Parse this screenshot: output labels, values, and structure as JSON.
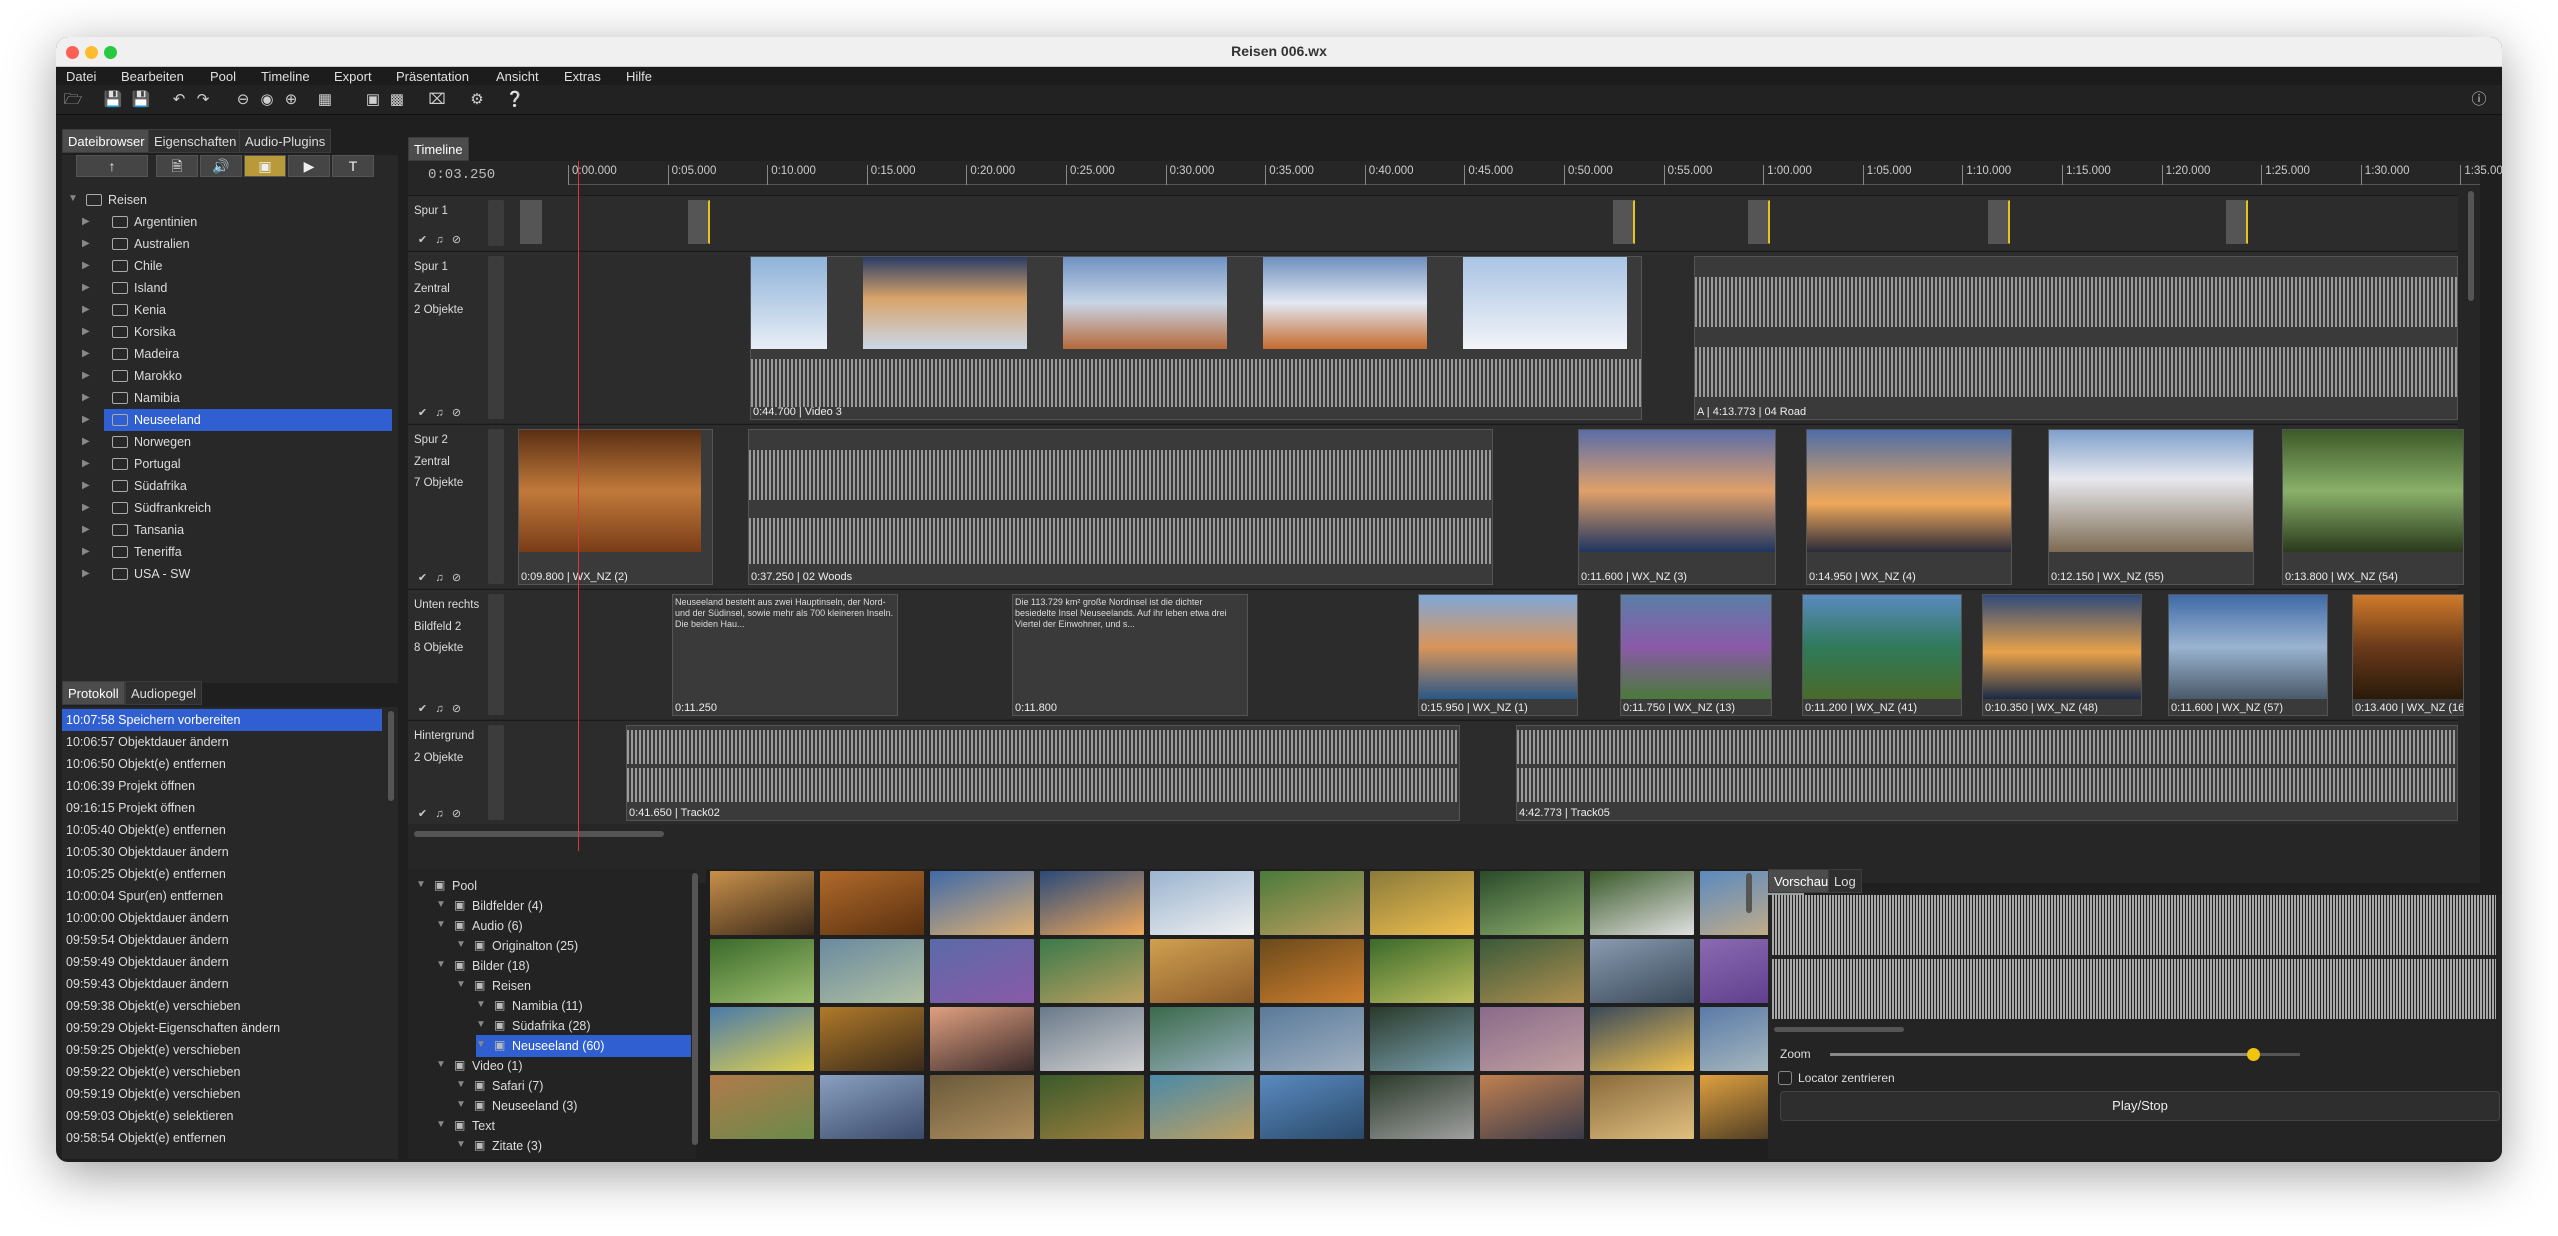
{
  "window": {
    "title": "Reisen 006.wx"
  },
  "menu": [
    "Datei",
    "Bearbeiten",
    "Pool",
    "Timeline",
    "Export",
    "Präsentation",
    "Ansicht",
    "Extras",
    "Hilfe"
  ],
  "left_tabs": [
    "Dateibrowser",
    "Eigenschaften",
    "Audio-Plugins"
  ],
  "file_tree": {
    "root": "Reisen",
    "items": [
      "Argentinien",
      "Australien",
      "Chile",
      "Island",
      "Kenia",
      "Korsika",
      "Madeira",
      "Marokko",
      "Namibia",
      "Neuseeland",
      "Norwegen",
      "Portugal",
      "Südafrika",
      "Südfrankreich",
      "Tansania",
      "Teneriffa",
      "USA - SW"
    ],
    "selected": "Neuseeland"
  },
  "log_tabs": [
    "Protokoll",
    "Audiopegel"
  ],
  "log": [
    {
      "time": "10:07:58",
      "text": "Speichern vorbereiten"
    },
    {
      "time": "10:06:57",
      "text": "Objektdauer ändern"
    },
    {
      "time": "10:06:50",
      "text": "Objekt(e) entfernen"
    },
    {
      "time": "10:06:39",
      "text": "Projekt öffnen"
    },
    {
      "time": "09:16:15",
      "text": "Projekt öffnen"
    },
    {
      "time": "10:05:40",
      "text": "Objekt(e) entfernen"
    },
    {
      "time": "10:05:30",
      "text": "Objektdauer ändern"
    },
    {
      "time": "10:05:25",
      "text": "Objekt(e) entfernen"
    },
    {
      "time": "10:00:04",
      "text": "Spur(en) entfernen"
    },
    {
      "time": "10:00:00",
      "text": "Objektdauer ändern"
    },
    {
      "time": "09:59:54",
      "text": "Objektdauer ändern"
    },
    {
      "time": "09:59:49",
      "text": "Objektdauer ändern"
    },
    {
      "time": "09:59:43",
      "text": "Objektdauer ändern"
    },
    {
      "time": "09:59:38",
      "text": "Objekt(e) verschieben"
    },
    {
      "time": "09:59:29",
      "text": "Objekt-Eigenschaften ändern"
    },
    {
      "time": "09:59:25",
      "text": "Objekt(e) verschieben"
    },
    {
      "time": "09:59:22",
      "text": "Objekt(e) verschieben"
    },
    {
      "time": "09:59:19",
      "text": "Objekt(e) verschieben"
    },
    {
      "time": "09:59:03",
      "text": "Objekt(e) selektieren"
    },
    {
      "time": "09:58:54",
      "text": "Objekt(e) entfernen"
    }
  ],
  "timeline": {
    "tab": "Timeline",
    "time_display": "0:03.250",
    "ruler": [
      "0:00.000",
      "0:05.000",
      "0:10.000",
      "0:15.000",
      "0:20.000",
      "0:25.000",
      "0:30.000",
      "0:35.000",
      "0:40.000",
      "0:45.000",
      "0:50.000",
      "0:55.000",
      "1:00.000",
      "1:05.000",
      "1:10.000",
      "1:15.000",
      "1:20.000",
      "1:25.000",
      "1:30.000",
      "1:35.000"
    ],
    "tracks": [
      {
        "lines": [
          "Spur 1"
        ],
        "objects": []
      },
      {
        "lines": [
          "Spur 1",
          "Zentral",
          "2 Objekte"
        ],
        "objects": [
          "0:44.700 | Video 3",
          "A | 4:13.773 | 04 Road"
        ]
      },
      {
        "lines": [
          "Spur 2",
          "Zentral",
          "7 Objekte"
        ],
        "objects": [
          "0:09.800 | WX_NZ (2)",
          "0:37.250 | 02 Woods",
          "0:11.600 | WX_NZ (3)",
          "0:14.950 | WX_NZ (4)",
          "0:12.150 | WX_NZ (55)",
          "0:13.800 | WX_NZ (54)"
        ]
      },
      {
        "lines": [
          "Unten rechts",
          "Bildfeld 2",
          "8 Objekte"
        ],
        "objects": [
          "0:11.250",
          "0:11.800",
          "0:15.950 | WX_NZ (1)",
          "0:11.750 | WX_NZ (13)",
          "0:11.200 | WX_NZ (41)",
          "0:10.350 | WX_NZ (48)",
          "0:11.600 | WX_NZ (57)",
          "0:13.400 | WX_NZ (16)"
        ]
      },
      {
        "lines": [
          "Hintergrund",
          "",
          "2 Objekte"
        ],
        "objects": [
          "0:41.650 | Track02",
          "4:42.773 | Track05"
        ]
      }
    ],
    "text_objects": [
      "Neuseeland besteht aus zwei Hauptinseln, der Nord- und der Südinsel, sowie mehr als 700 kleineren Inseln. Die beiden Hau...",
      "Die 113.729 km² große Nordinsel ist die dichter besiedelte Insel Neuseelands. Auf ihr leben etwa drei Viertel der Einwohner, und s..."
    ]
  },
  "pool": {
    "items": [
      {
        "label": "Pool",
        "level": 0
      },
      {
        "label": "Bildfelder (4)",
        "level": 1
      },
      {
        "label": "Audio (6)",
        "level": 1
      },
      {
        "label": "Originalton (25)",
        "level": 2
      },
      {
        "label": "Bilder (18)",
        "level": 1
      },
      {
        "label": "Reisen",
        "level": 2
      },
      {
        "label": "Namibia (11)",
        "level": 3
      },
      {
        "label": "Südafrika (28)",
        "level": 3
      },
      {
        "label": "Neuseeland (60)",
        "level": 3
      },
      {
        "label": "Video (1)",
        "level": 1
      },
      {
        "label": "Safari (7)",
        "level": 2
      },
      {
        "label": "Neuseeland (3)",
        "level": 2
      },
      {
        "label": "Text",
        "level": 1
      },
      {
        "label": "Zitate (3)",
        "level": 2
      }
    ],
    "selected": "Neuseeland (60)"
  },
  "preview": {
    "tabs": [
      "Vorschau",
      "Log"
    ],
    "zoom_label": "Zoom",
    "zoom_level": 0.9,
    "locator_label": "Locator zentrieren",
    "play_label": "Play/Stop"
  },
  "colors": {
    "accent": "#2f5fd0",
    "playhead": "#d63a3a",
    "marker": "#e8c31a"
  }
}
